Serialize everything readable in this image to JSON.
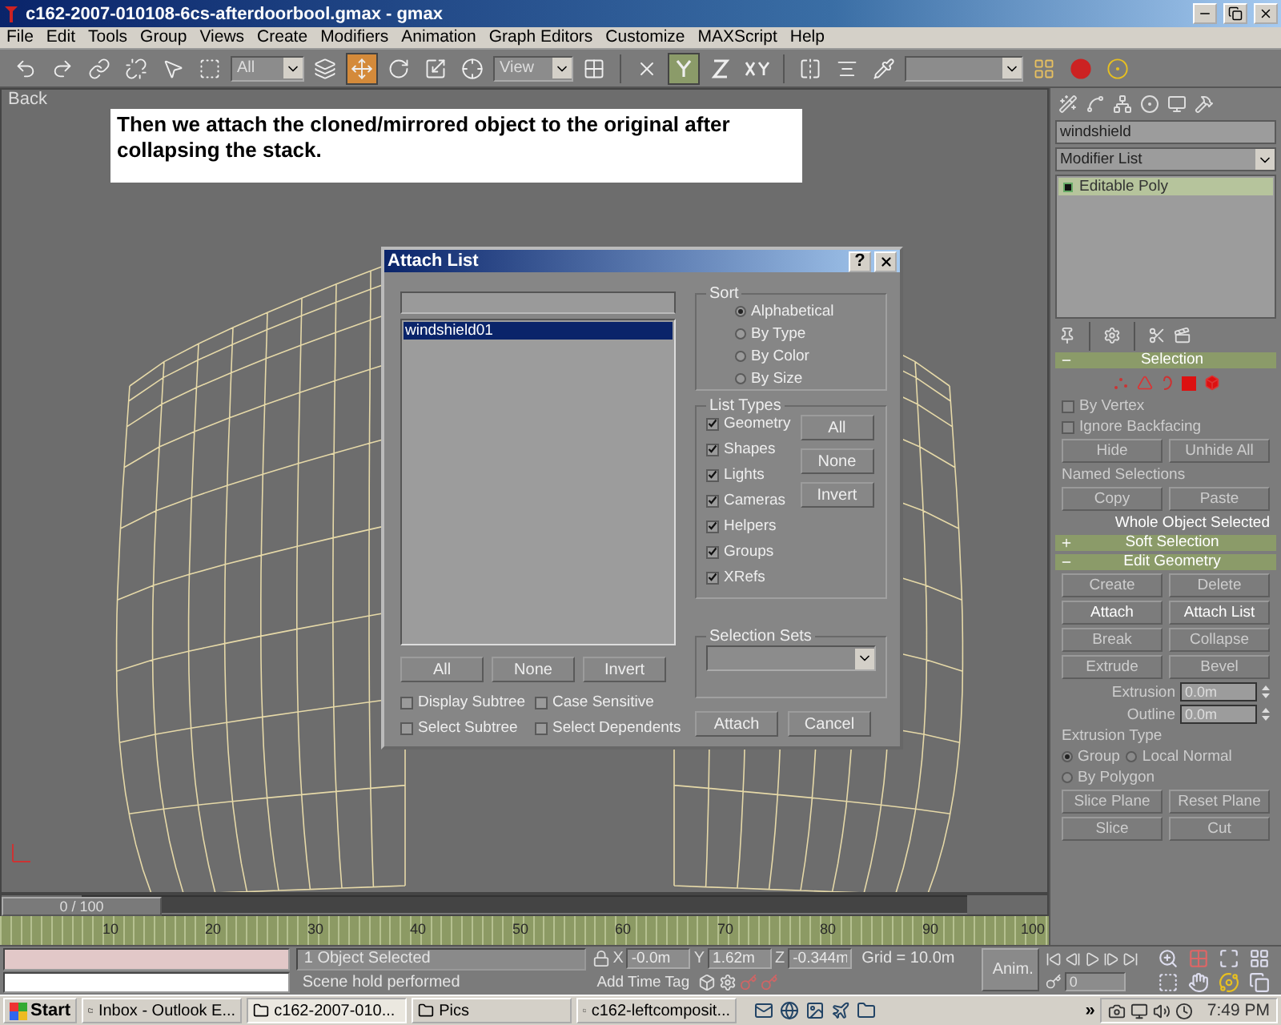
{
  "window": {
    "title": "c162-2007-010108-6cs-afterdoorbool.gmax - gmax"
  },
  "menu": [
    "File",
    "Edit",
    "Tools",
    "Group",
    "Views",
    "Create",
    "Modifiers",
    "Animation",
    "Graph Editors",
    "Customize",
    "MAXScript",
    "Help"
  ],
  "toolbar": {
    "selection_filter": "All",
    "coordinate_system": "View",
    "move_tool_selected": true,
    "y_constraint_selected": true
  },
  "viewport": {
    "label": "Back",
    "caption": "Then we attach the cloned/mirrored object to the original after collapsing the stack."
  },
  "attach_dialog": {
    "title": "Attach List",
    "help": "?",
    "list_items": [
      {
        "label": "windshield01",
        "selected": true
      }
    ],
    "list_buttons": [
      "All",
      "None",
      "Invert"
    ],
    "options": [
      {
        "label": "Display Subtree",
        "checked": false
      },
      {
        "label": "Case Sensitive",
        "checked": false
      },
      {
        "label": "Select Subtree",
        "checked": false
      },
      {
        "label": "Select Dependents",
        "checked": false
      }
    ],
    "sort": {
      "title": "Sort",
      "options": [
        {
          "label": "Alphabetical",
          "selected": true
        },
        {
          "label": "By Type",
          "selected": false
        },
        {
          "label": "By Color",
          "selected": false
        },
        {
          "label": "By Size",
          "selected": false
        }
      ]
    },
    "list_types": {
      "title": "List Types",
      "items": [
        {
          "label": "Geometry",
          "checked": true
        },
        {
          "label": "Shapes",
          "checked": true
        },
        {
          "label": "Lights",
          "checked": true
        },
        {
          "label": "Cameras",
          "checked": true
        },
        {
          "label": "Helpers",
          "checked": true
        },
        {
          "label": "Groups",
          "checked": true
        },
        {
          "label": "XRefs",
          "checked": true
        }
      ],
      "buttons": [
        "All",
        "None",
        "Invert"
      ]
    },
    "selection_sets": {
      "title": "Selection Sets"
    },
    "actions": [
      "Attach",
      "Cancel"
    ]
  },
  "command_panel": {
    "object_name": "windshield",
    "modifier_list": "Modifier List",
    "stack": [
      {
        "label": "Editable Poly",
        "selected": true
      }
    ],
    "selection": {
      "title": "Selection",
      "expanded": true,
      "checkboxes": [
        {
          "label": "By Vertex",
          "checked": false,
          "disabled": true
        },
        {
          "label": "Ignore Backfacing",
          "checked": false,
          "disabled": true
        }
      ],
      "buttons": [
        {
          "label": "Hide",
          "disabled": true
        },
        {
          "label": "Unhide All",
          "disabled": true
        }
      ],
      "named_selections": "Named Selections",
      "named_buttons": [
        {
          "label": "Copy",
          "disabled": true
        },
        {
          "label": "Paste",
          "disabled": true
        }
      ],
      "status": "Whole Object Selected"
    },
    "soft_selection": {
      "title": "Soft Selection",
      "expanded": false
    },
    "edit_geometry": {
      "title": "Edit Geometry",
      "expanded": true,
      "buttons": [
        {
          "label": "Create",
          "disabled": true
        },
        {
          "label": "Delete",
          "disabled": true
        },
        {
          "label": "Attach",
          "disabled": false
        },
        {
          "label": "Attach List",
          "disabled": false
        },
        {
          "label": "Break",
          "disabled": true
        },
        {
          "label": "Collapse",
          "disabled": true
        }
      ],
      "extrude_buttons": [
        {
          "label": "Extrude",
          "disabled": true
        },
        {
          "label": "Bevel",
          "disabled": true
        }
      ],
      "fields": [
        {
          "label": "Extrusion",
          "value": "0.0m"
        },
        {
          "label": "Outline",
          "value": "0.0m"
        }
      ],
      "extrusion_type": {
        "title": "Extrusion Type",
        "options": [
          {
            "label": "Group",
            "selected": true
          },
          {
            "label": "Local Normal",
            "selected": false
          },
          {
            "label": "By Polygon",
            "selected": false
          }
        ]
      },
      "slice_buttons": [
        {
          "label": "Slice Plane",
          "disabled": true
        },
        {
          "label": "Reset Plane",
          "disabled": true
        },
        {
          "label": "Slice",
          "disabled": true
        },
        {
          "label": "Cut",
          "disabled": true
        }
      ]
    }
  },
  "timeline": {
    "slider": "0 / 100",
    "level": 0,
    "ticks": [
      "10",
      "20",
      "30",
      "40",
      "50",
      "60",
      "70",
      "80",
      "90",
      "100"
    ]
  },
  "status_bar": {
    "selection": "1 Object Selected",
    "prompt": "Scene hold performed",
    "coords": [
      {
        "axis": "X",
        "value": "-0.0m"
      },
      {
        "axis": "Y",
        "value": "1.62m"
      },
      {
        "axis": "Z",
        "value": "-0.344m"
      }
    ],
    "grid": "Grid = 10.0m",
    "time_tag": "Add Time Tag",
    "anim": "Anim.",
    "frame": "0"
  },
  "taskbar": {
    "start": "Start",
    "tasks": [
      {
        "label": "Inbox - Outlook E...",
        "selected": false
      },
      {
        "label": "c162-2007-010...",
        "selected": true
      },
      {
        "label": "Pics",
        "selected": false
      },
      {
        "label": "c162-leftcomposit...",
        "selected": false
      }
    ],
    "more": "»",
    "clock": "7:49 PM"
  }
}
